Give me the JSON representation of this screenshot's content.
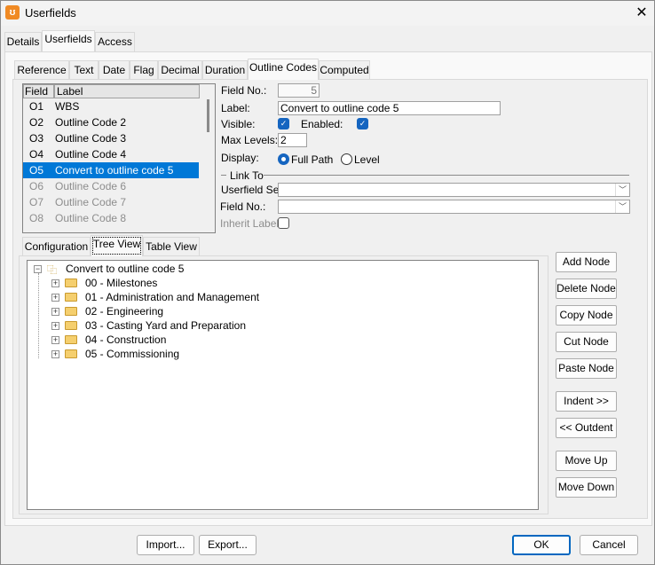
{
  "window": {
    "title": "Userfields",
    "close": "✕",
    "icon": "app-logo"
  },
  "top_tabs": [
    "Details",
    "Userfields",
    "Access"
  ],
  "top_tab_selected": "Userfields",
  "inner_tabs": [
    "Reference",
    "Text",
    "Date",
    "Flag",
    "Decimal",
    "Duration",
    "Outline Codes",
    "Computed"
  ],
  "inner_tab_selected": "Outline Codes",
  "list": {
    "headers": [
      "Field",
      "Label"
    ],
    "rows": [
      {
        "field": "O1",
        "label": "WBS",
        "state": "normal"
      },
      {
        "field": "O2",
        "label": "Outline Code 2",
        "state": "normal"
      },
      {
        "field": "O3",
        "label": "Outline Code 3",
        "state": "normal"
      },
      {
        "field": "O4",
        "label": "Outline Code 4",
        "state": "normal"
      },
      {
        "field": "O5",
        "label": "Convert to outline code 5",
        "state": "selected"
      },
      {
        "field": "O6",
        "label": "Outline Code 6",
        "state": "disabled"
      },
      {
        "field": "O7",
        "label": "Outline Code 7",
        "state": "disabled"
      },
      {
        "field": "O8",
        "label": "Outline Code 8",
        "state": "disabled"
      }
    ]
  },
  "form": {
    "field_no_label": "Field No.:",
    "field_no_value": "5",
    "label_label": "Label:",
    "label_value": "Convert to outline code 5",
    "visible_label": "Visible:",
    "visible": true,
    "enabled_label": "Enabled:",
    "enabled": true,
    "max_levels_label": "Max Levels:",
    "max_levels_value": "2",
    "display_label": "Display:",
    "display_options": [
      "Full Path",
      "Level"
    ],
    "display_selected": "Full Path",
    "link_to": "Link To",
    "userfield_set_label": "Userfield Set:",
    "userfield_set_value": "",
    "link_field_no_label": "Field No.:",
    "link_field_no_value": "",
    "inherit_label": "Inherit Label:",
    "inherit": false
  },
  "sub_tabs": [
    "Configuration",
    "Tree View",
    "Table View"
  ],
  "sub_tab_selected": "Tree View",
  "tree": {
    "root": "Convert to outline code 5",
    "children": [
      "00 - Milestones",
      "01 - Administration and Management",
      "02 - Engineering",
      "03 - Casting Yard and Preparation",
      "04 - Construction",
      "05 - Commissioning"
    ]
  },
  "node_buttons": [
    "Add Node",
    "Delete Node",
    "Copy Node",
    "Cut Node",
    "Paste Node",
    "Indent >>",
    "<< Outdent",
    "Move Up",
    "Move Down"
  ],
  "footer": {
    "import": "Import...",
    "export": "Export...",
    "ok": "OK",
    "cancel": "Cancel"
  },
  "colors": {
    "accent": "#0078d7",
    "checkbox": "#1565c0",
    "app_icon": "#f08a24"
  }
}
